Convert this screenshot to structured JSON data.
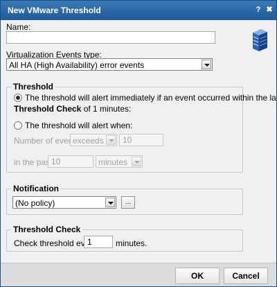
{
  "window": {
    "title": "New VMware Threshold",
    "help_glyph": "?",
    "close_glyph": "✖"
  },
  "name_field": {
    "label": "Name:",
    "value": ""
  },
  "events_type": {
    "label": "Virtualization Events type:",
    "selected": "All HA (High Availability) error events"
  },
  "threshold": {
    "title": "Threshold",
    "option1_line1": "The threshold will alert immediately if an event occurred within the last",
    "option1_bold": "Threshold Check",
    "option1_tail": " of 1 minutes:",
    "option2_label": "The threshold will alert when:",
    "num_events_label": "Number of events",
    "comparison": "exceeds",
    "count": "10",
    "in_past_label": "in the past",
    "past_value": "10",
    "past_unit": "minutes"
  },
  "notification": {
    "title": "Notification",
    "policy": "(No policy)",
    "more_button": "..."
  },
  "threshold_check": {
    "title": "Threshold Check",
    "label": "Check threshold every",
    "value": "1",
    "unit": "minutes."
  },
  "footer": {
    "ok": "OK",
    "cancel": "Cancel"
  }
}
